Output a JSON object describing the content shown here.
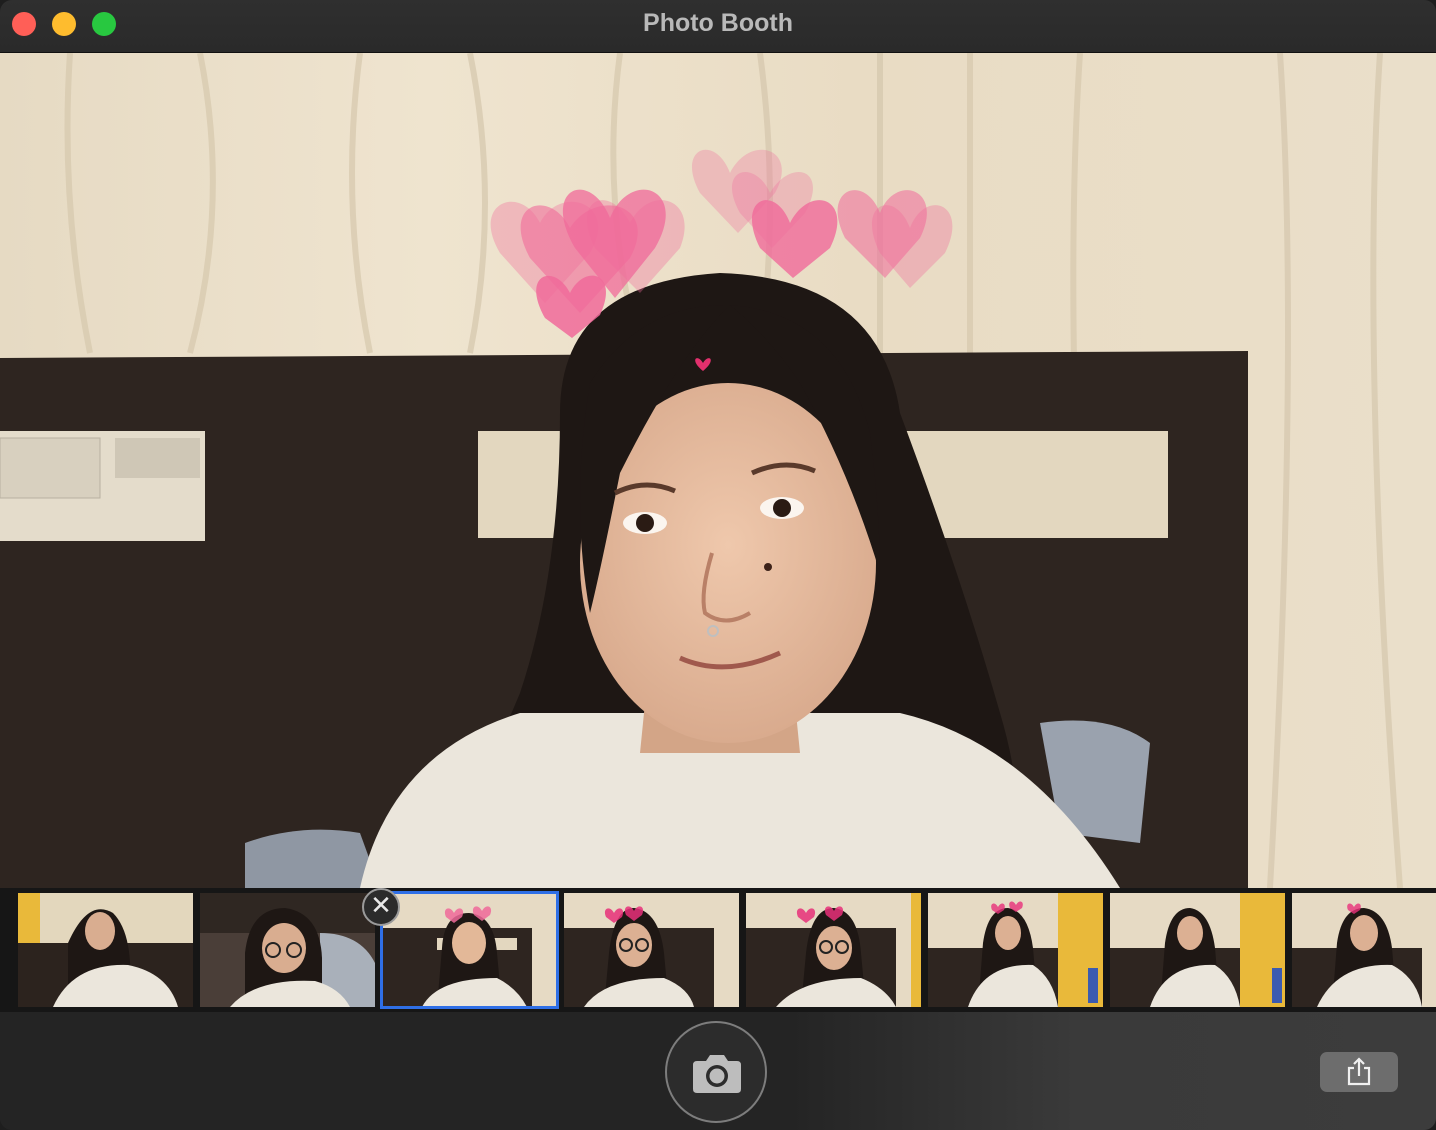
{
  "window": {
    "title": "Photo Booth"
  },
  "toolbar": {
    "close": "close-window",
    "minimize": "minimize-window",
    "zoom": "zoom-window"
  },
  "filmstrip": {
    "selected_index": 2,
    "thumbnail_count": 8
  },
  "controls": {
    "shutter_icon": "camera-icon",
    "share_icon": "share-icon",
    "delete_icon": "close-icon"
  },
  "colors": {
    "selection": "#2f6fe6",
    "close": "#ff5f57",
    "minimize": "#febc2e",
    "zoom": "#28c840",
    "hearts": "#f06a9a"
  }
}
